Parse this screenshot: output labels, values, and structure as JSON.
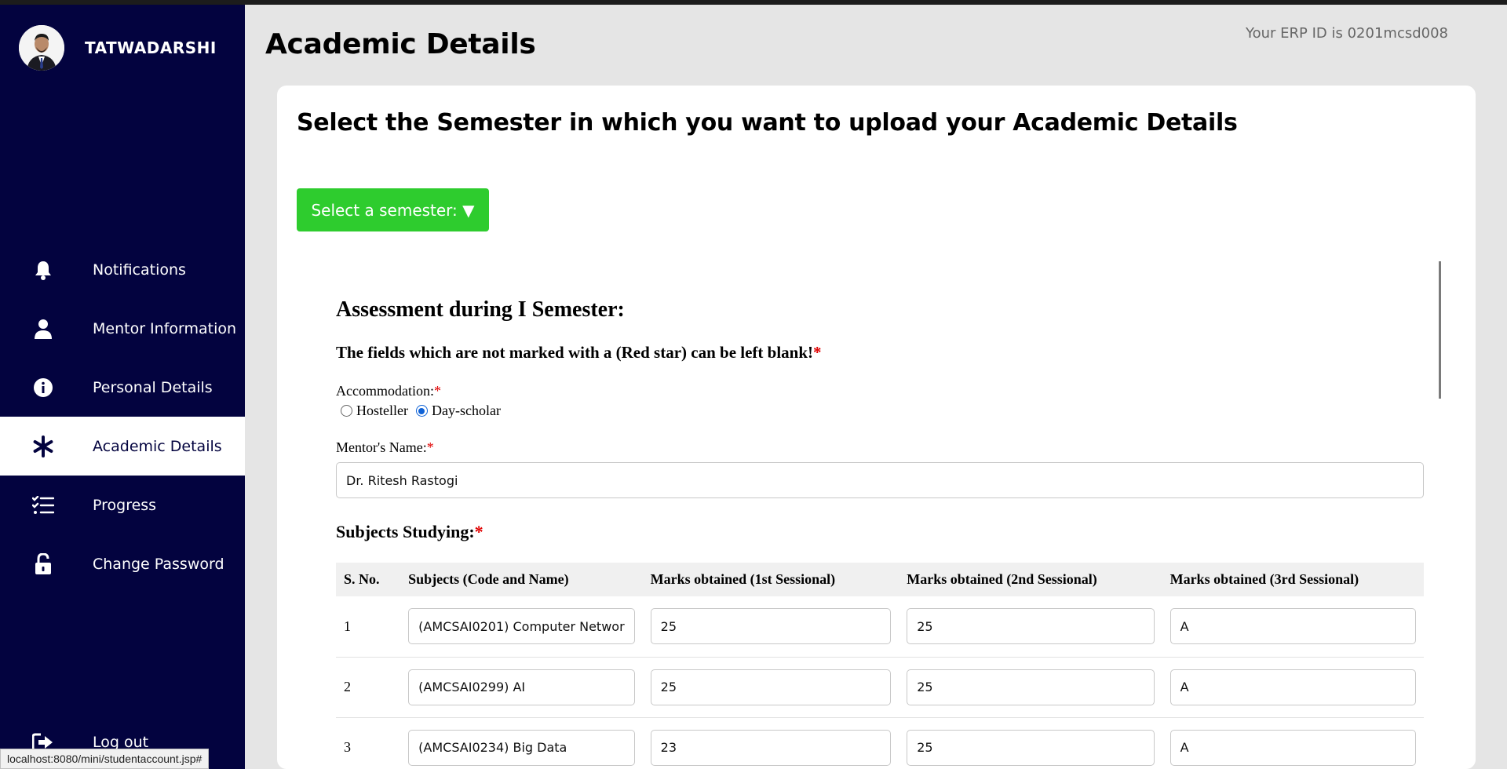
{
  "user": {
    "name": "TATWADARSHI"
  },
  "nav": {
    "items": [
      {
        "label": "Notifications",
        "icon": "bell-icon"
      },
      {
        "label": "Mentor Information",
        "icon": "user-icon"
      },
      {
        "label": "Personal Details",
        "icon": "info-icon"
      },
      {
        "label": "Academic Details",
        "icon": "asterisk-icon",
        "active": true
      },
      {
        "label": "Progress",
        "icon": "checklist-icon"
      },
      {
        "label": "Change Password",
        "icon": "unlock-icon"
      }
    ],
    "logout_label": "Log out"
  },
  "status_url": "localhost:8080/mini/studentaccount.jsp#",
  "page": {
    "title": "Academic Details",
    "erp_text": "Your ERP ID is 0201mcsd008"
  },
  "card": {
    "heading": "Select the Semester in which you want to upload your Academic Details",
    "semester_button": "Select a semester: ▼"
  },
  "form": {
    "assessment_title": "Assessment during I Semester:",
    "note": "The fields which are not marked with a (Red star) can be left blank!",
    "required_mark": "*",
    "accommodation_label": "Accommodation:",
    "accommodation_options": [
      "Hosteller",
      "Day-scholar"
    ],
    "accommodation_selected": "Day-scholar",
    "mentor_label": "Mentor's Name:",
    "mentor_value": "Dr. Ritesh Rastogi",
    "subjects_label": "Subjects Studying:",
    "table": {
      "headers": [
        "S. No.",
        "Subjects (Code and Name)",
        "Marks obtained (1st Sessional)",
        "Marks obtained (2nd Sessional)",
        "Marks obtained (3rd Sessional)"
      ],
      "rows": [
        {
          "sno": "1",
          "subject": "(AMCSAI0201) Computer Networ",
          "m1": "25",
          "m2": "25",
          "m3": "A"
        },
        {
          "sno": "2",
          "subject": "(AMCSAI0299) AI",
          "m1": "25",
          "m2": "25",
          "m3": "A"
        },
        {
          "sno": "3",
          "subject": "(AMCSAI0234) Big Data",
          "m1": "23",
          "m2": "25",
          "m3": "A"
        }
      ]
    }
  },
  "colors": {
    "sidebar_bg": "#03033f",
    "button_green": "#2ecc2e",
    "required_red": "#e00000"
  }
}
